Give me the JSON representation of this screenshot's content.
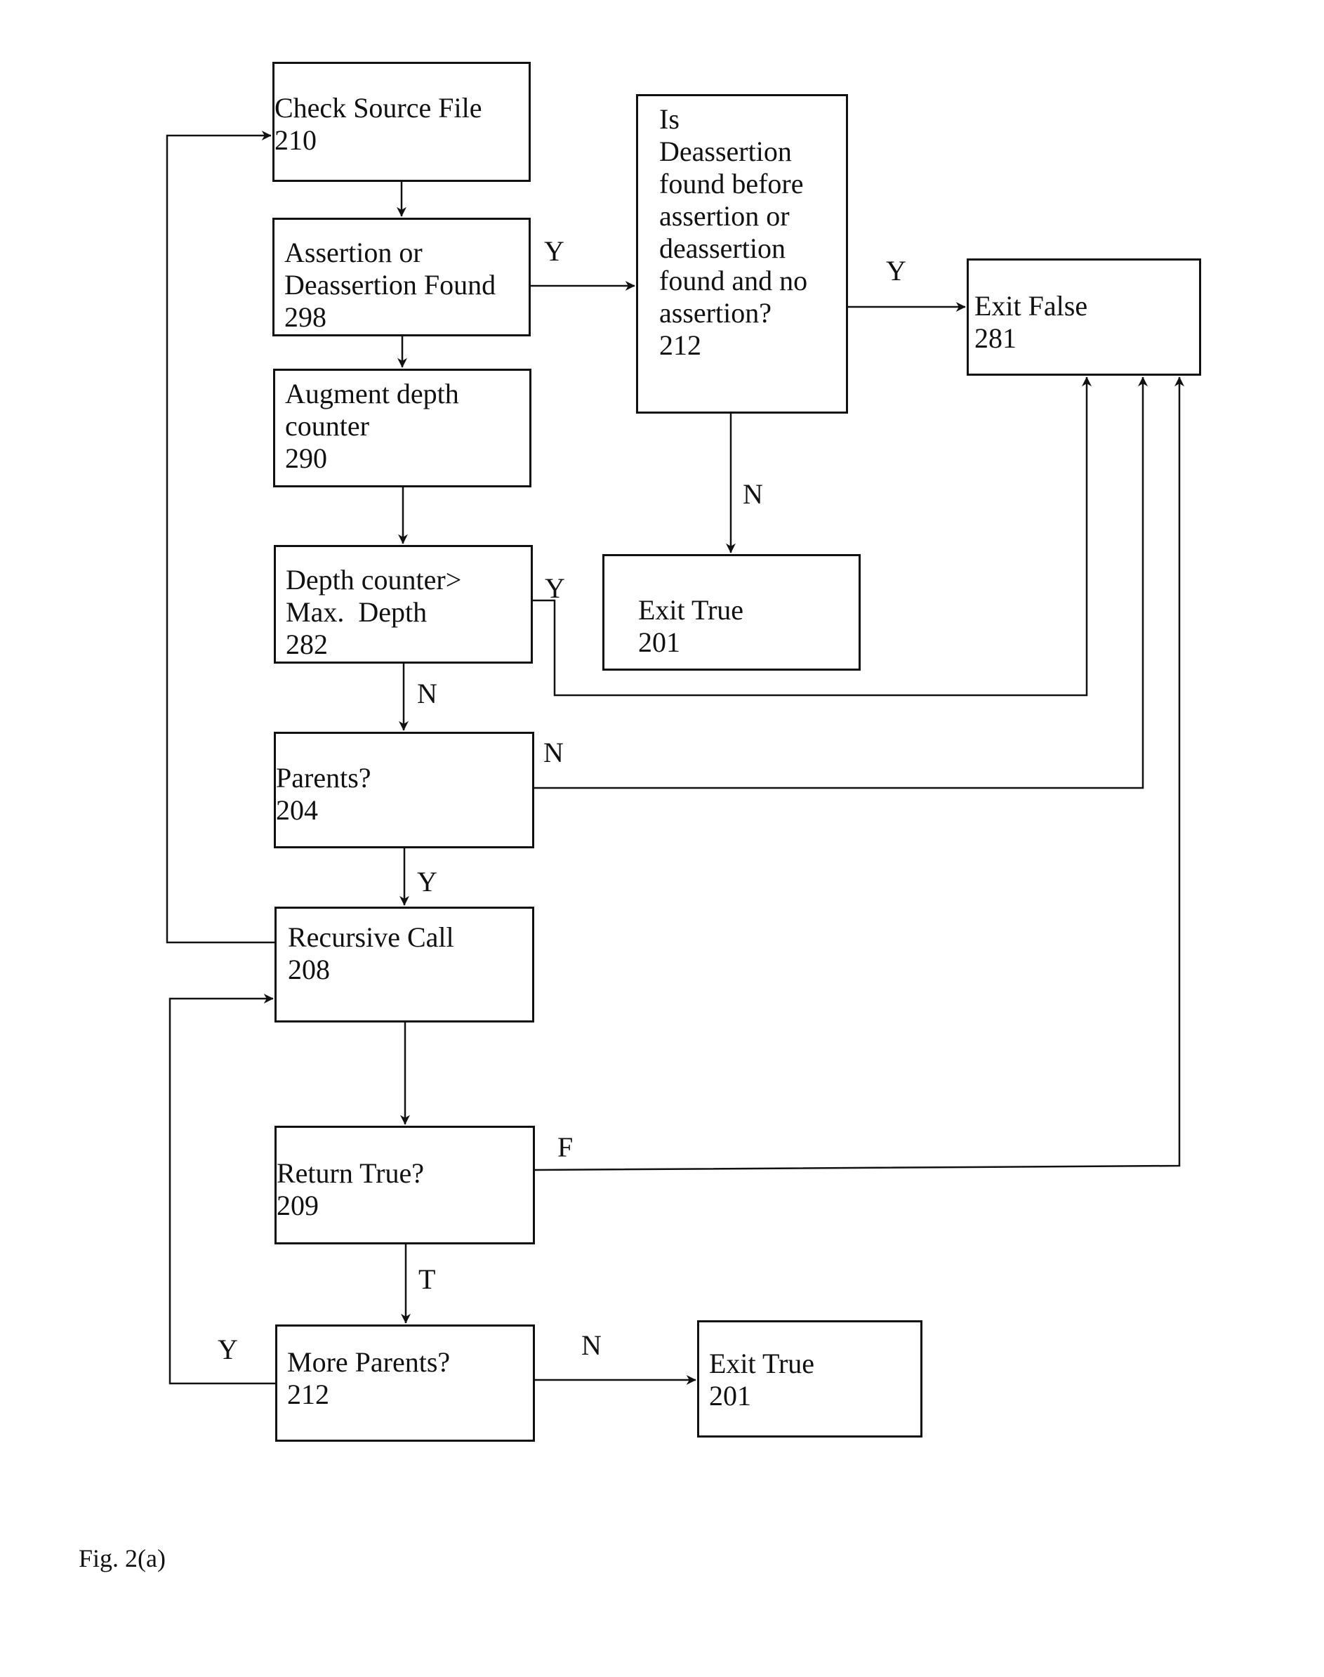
{
  "figure": {
    "caption": "Fig. 2(a)",
    "nodes": {
      "check_source": {
        "text": "Check Source File",
        "id": "210"
      },
      "assertion_found": {
        "text": "Assertion or\nDeassertion Found",
        "id": "298"
      },
      "augment_depth": {
        "text": "Augment depth\ncounter",
        "id": "290"
      },
      "depth_check": {
        "text": "Depth counter>\nMax.  Depth",
        "id": "282"
      },
      "parents": {
        "text": "Parents?",
        "id": "204"
      },
      "recursive_call": {
        "text": "Recursive Call",
        "id": "208"
      },
      "return_true": {
        "text": "Return True?",
        "id": "209"
      },
      "more_parents": {
        "text": "More Parents?",
        "id": "212"
      },
      "deassertion_check": {
        "text": "Is\nDeassertion\nfound before\nassertion or\ndeassertion\nfound and no\nassertion?",
        "id": "212"
      },
      "exit_false": {
        "text": "Exit False",
        "id": "281"
      },
      "exit_true_top": {
        "text": "Exit True",
        "id": "201"
      },
      "exit_true_bottom": {
        "text": "Exit True",
        "id": "201"
      }
    },
    "edge_labels": {
      "assertion_found_y": "Y",
      "deassertion_y": "Y",
      "deassertion_n": "N",
      "depth_y": "Y",
      "depth_n": "N",
      "parents_n": "N",
      "parents_y": "Y",
      "return_false": "F",
      "return_true": "T",
      "more_parents_y": "Y",
      "more_parents_n": "N"
    }
  }
}
